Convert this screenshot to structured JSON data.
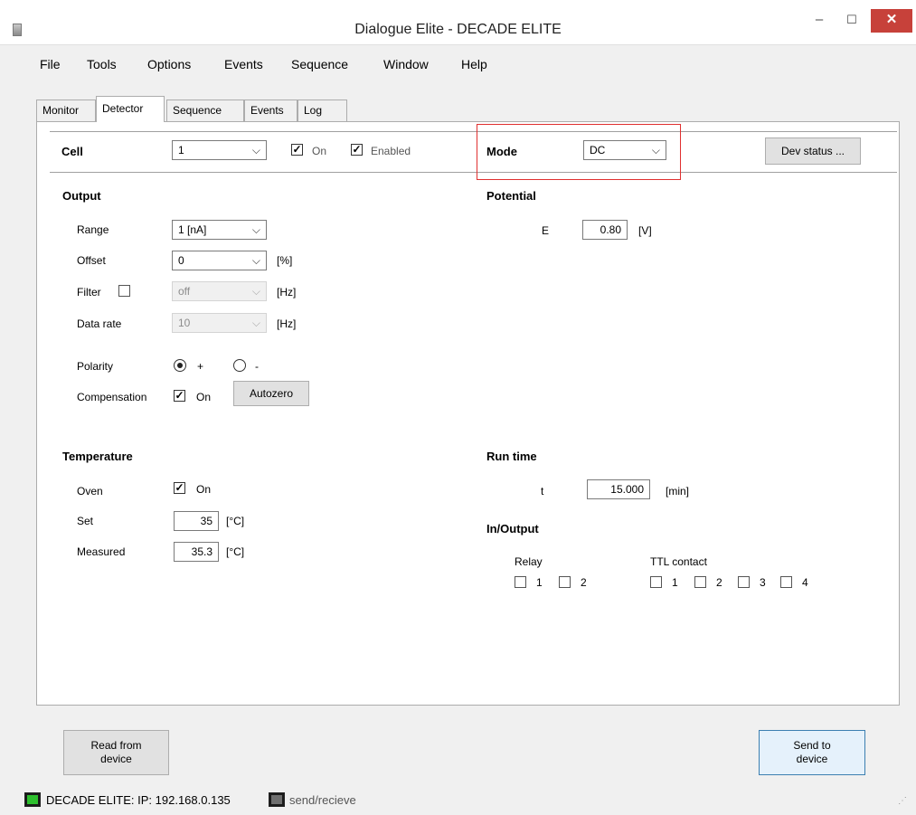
{
  "window": {
    "title": "Dialogue Elite - DECADE ELITE",
    "minimize": "–",
    "maximize": "☐",
    "close": "✕"
  },
  "menu": [
    "File",
    "Tools",
    "Options",
    "Events",
    "Sequence",
    "Window",
    "Help"
  ],
  "tabs": [
    "Monitor",
    "Detector",
    "Sequence",
    "Events",
    "Log"
  ],
  "active_tab": "Detector",
  "cell": {
    "label": "Cell",
    "value": "1",
    "on_label": "On",
    "on_checked": true,
    "enabled_label": "Enabled",
    "enabled_checked": true
  },
  "mode": {
    "label": "Mode",
    "value": "DC"
  },
  "dev_status_button": "Dev status ...",
  "output": {
    "title": "Output",
    "range_label": "Range",
    "range_value": "1 [nA]",
    "offset_label": "Offset",
    "offset_value": "0",
    "offset_unit": "[%]",
    "filter_label": "Filter",
    "filter_checked": false,
    "filter_value": "off",
    "filter_unit": "[Hz]",
    "datarate_label": "Data rate",
    "datarate_value": "10",
    "datarate_unit": "[Hz]",
    "polarity_label": "Polarity",
    "polarity_plus": "+",
    "polarity_minus": "-",
    "polarity_selected": "+",
    "compensation_label": "Compensation",
    "compensation_on_label": "On",
    "compensation_checked": true,
    "autozero_button": "Autozero"
  },
  "potential": {
    "title": "Potential",
    "e_label": "E",
    "e_value": "0.80",
    "e_unit": "[V]"
  },
  "temperature": {
    "title": "Temperature",
    "oven_label": "Oven",
    "oven_on_label": "On",
    "oven_checked": true,
    "set_label": "Set",
    "set_value": "35",
    "set_unit": "[°C]",
    "measured_label": "Measured",
    "measured_value": "35.3",
    "measured_unit": "[°C]"
  },
  "runtime": {
    "title": "Run time",
    "t_label": "t",
    "t_value": "15.000",
    "t_unit": "[min]"
  },
  "inout": {
    "title": "In/Output",
    "relay_label": "Relay",
    "relay_items": [
      "1",
      "2"
    ],
    "ttl_label": "TTL contact",
    "ttl_items": [
      "1",
      "2",
      "3",
      "4"
    ]
  },
  "buttons": {
    "read_from_device_line1": "Read from",
    "read_from_device_line2": "device",
    "send_to_device_line1": "Send to",
    "send_to_device_line2": "device"
  },
  "status": {
    "device_text": "DECADE ELITE:  IP: 192.168.0.135",
    "send_text": "send/recieve",
    "led_color": "#2ec02e"
  }
}
